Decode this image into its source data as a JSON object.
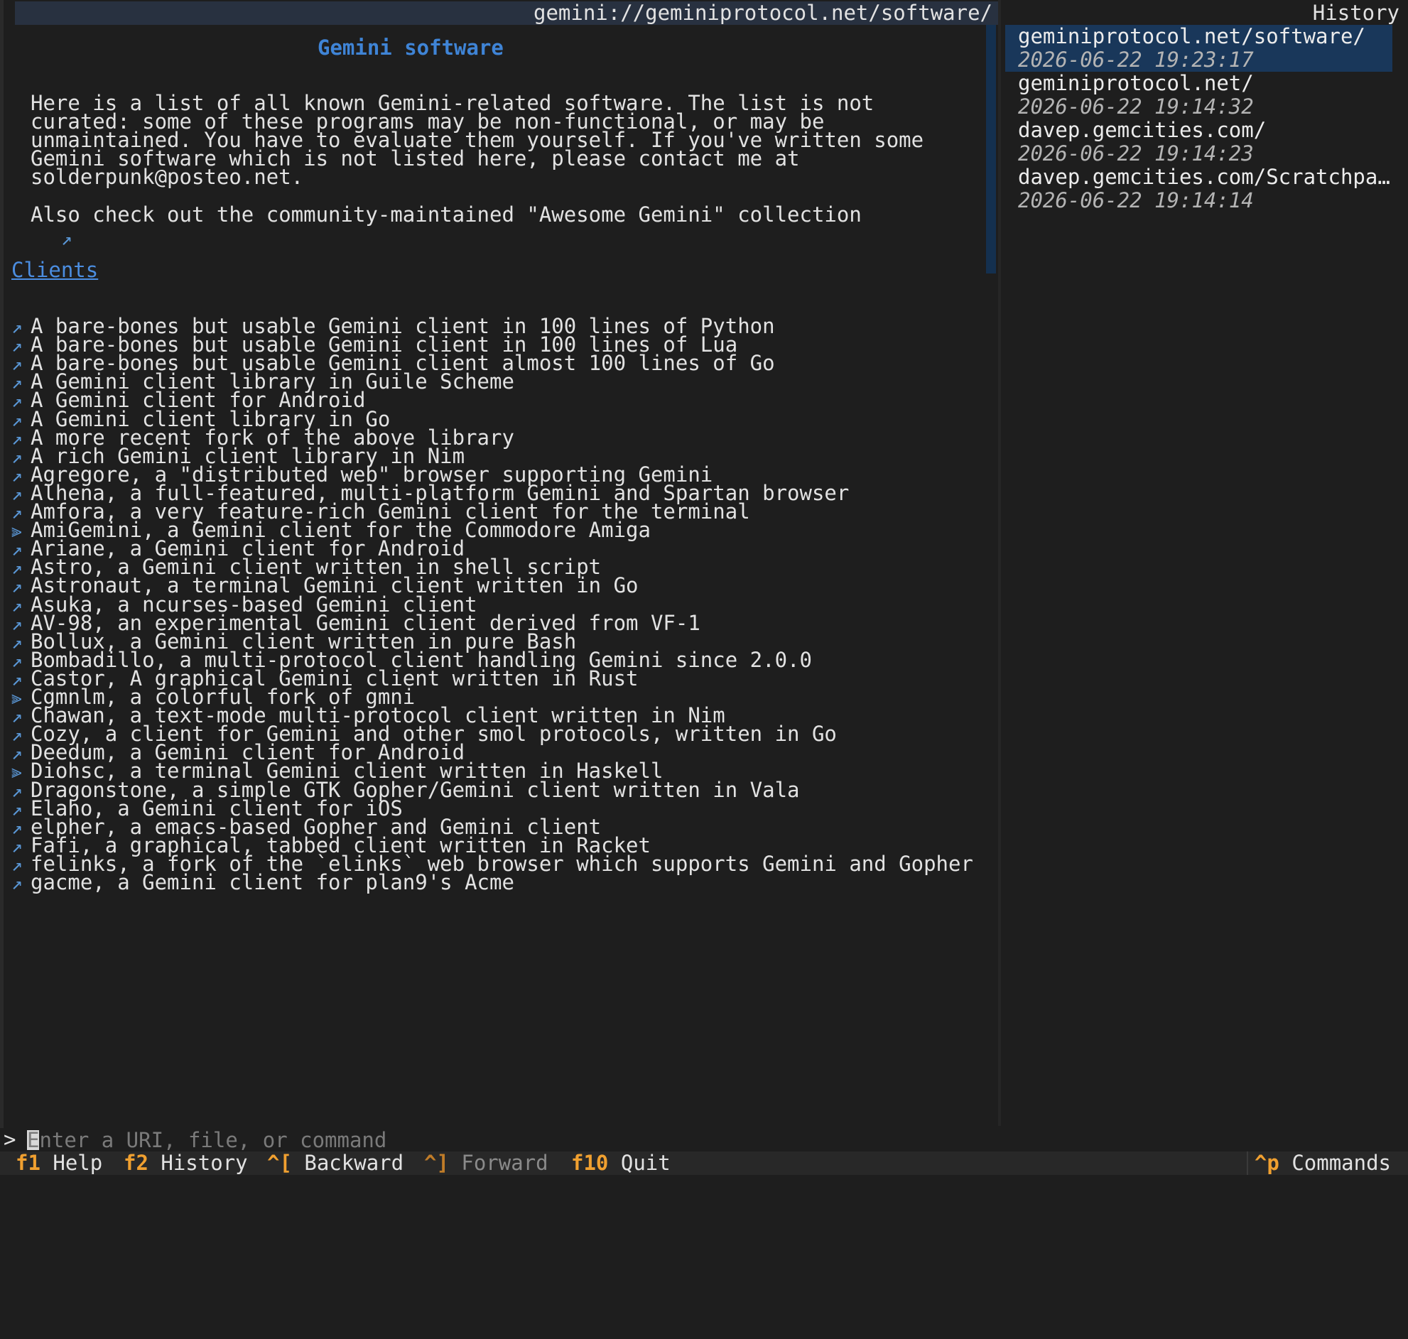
{
  "main": {
    "url": "gemini://geminiprotocol.net/software/",
    "heading": "Gemini software",
    "intro": [
      "Here is a list of all known Gemini-related software. The list is not",
      "curated: some of these programs may be non-functional, or may be",
      "unmaintained. You have to evaluate them yourself. If you've written some",
      "Gemini software which is not listed here, please contact me at",
      "solderpunk@posteo.net."
    ],
    "awesome_link": "Also check out the community-maintained \"Awesome Gemini\" collection",
    "section": "Clients",
    "links": [
      {
        "text": "A bare-bones but usable Gemini client in 100 lines of Python",
        "glyph": "↗"
      },
      {
        "text": "A bare-bones but usable Gemini client in 100 lines of Lua",
        "glyph": "↗"
      },
      {
        "text": "A bare-bones but usable Gemini client almost 100 lines of Go",
        "glyph": "↗"
      },
      {
        "text": "A Gemini client library in Guile Scheme",
        "glyph": "↗"
      },
      {
        "text": "A Gemini client for Android",
        "glyph": "↗"
      },
      {
        "text": "A Gemini client library in Go",
        "glyph": "↗"
      },
      {
        "text": "A more recent fork of the above library",
        "glyph": "↗"
      },
      {
        "text": "A rich Gemini client library in Nim",
        "glyph": "↗"
      },
      {
        "text": "Agregore, a \"distributed web\" browser supporting Gemini",
        "glyph": "↗"
      },
      {
        "text": "Alhena, a full-featured, multi-platform Gemini and Spartan browser",
        "glyph": "↗"
      },
      {
        "text": "Amfora, a very feature-rich Gemini client for the terminal",
        "glyph": "↗"
      },
      {
        "text": "AmiGemini, a Gemini client for the Commodore Amiga",
        "glyph": "⫸"
      },
      {
        "text": "Ariane, a Gemini client for Android",
        "glyph": "↗"
      },
      {
        "text": "Astro, a Gemini client written in shell script",
        "glyph": "↗"
      },
      {
        "text": "Astronaut, a terminal Gemini client written in Go",
        "glyph": "↗"
      },
      {
        "text": "Asuka, a ncurses-based Gemini client",
        "glyph": "↗"
      },
      {
        "text": "AV-98, an experimental Gemini client derived from VF-1",
        "glyph": "↗"
      },
      {
        "text": "Bollux, a Gemini client written in pure Bash",
        "glyph": "↗"
      },
      {
        "text": "Bombadillo, a multi-protocol client handling Gemini since 2.0.0",
        "glyph": "↗"
      },
      {
        "text": "Castor, A graphical Gemini client written in Rust",
        "glyph": "↗"
      },
      {
        "text": "Cgmnlm, a colorful fork of gmni",
        "glyph": "⫸"
      },
      {
        "text": "Chawan, a text-mode multi-protocol client written in Nim",
        "glyph": "↗"
      },
      {
        "text": "Cozy, a client for Gemini and other smol protocols, written in Go",
        "glyph": "↗"
      },
      {
        "text": "Deedum, a Gemini client for Android",
        "glyph": "↗"
      },
      {
        "text": "Diohsc, a terminal Gemini client written in Haskell",
        "glyph": "⫸"
      },
      {
        "text": "Dragonstone, a simple GTK Gopher/Gemini client written in Vala",
        "glyph": "↗"
      },
      {
        "text": "Elaho, a Gemini client for iOS",
        "glyph": "↗"
      },
      {
        "text": "elpher, a emacs-based Gopher and Gemini client",
        "glyph": "↗"
      },
      {
        "text": "Fafi, a graphical, tabbed client written in Racket",
        "glyph": "↗"
      },
      {
        "text": "felinks, a fork of the `elinks` web browser which supports Gemini and Gopher",
        "glyph": "↗"
      },
      {
        "text": "gacme, a Gemini client for plan9's Acme",
        "glyph": "↗"
      }
    ]
  },
  "history": {
    "title": "History",
    "entries": [
      {
        "url": "geminiprotocol.net/software/",
        "time": "2026-06-22 19:23:17"
      },
      {
        "url": "geminiprotocol.net/",
        "time": "2026-06-22 19:14:32"
      },
      {
        "url": "davep.gemcities.com/",
        "time": "2026-06-22 19:14:23"
      },
      {
        "url": "davep.gemcities.com/Scratchpad…",
        "time": "2026-06-22 19:14:14"
      }
    ]
  },
  "input": {
    "prompt": ">",
    "placeholder": "Enter a URI, file, or command"
  },
  "footer": {
    "items": [
      {
        "key": "f1",
        "label": "Help"
      },
      {
        "key": "f2",
        "label": "History"
      },
      {
        "key": "^[",
        "label": "Backward"
      },
      {
        "key": "^]",
        "label": "Forward"
      },
      {
        "key": "f10",
        "label": "Quit"
      }
    ],
    "commands": {
      "key": "^p",
      "label": "Commands"
    }
  },
  "colors": {
    "background": "#1e1e1e",
    "heading": "#3f84d6",
    "link_glyph": "#5a97d6",
    "footer_key": "#f0a030",
    "history_selected": "#19375a"
  }
}
